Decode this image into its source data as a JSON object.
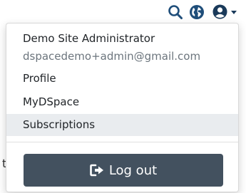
{
  "navbar": {
    "icons": [
      "search-icon",
      "globe-icon",
      "user-circle-icon",
      "caret-down-icon"
    ],
    "icon_color": "#1f4e7a"
  },
  "background": {
    "text": "t"
  },
  "user_menu": {
    "name": "Demo Site Administrator",
    "email": "dspacedemo+admin@gmail.com",
    "items": [
      {
        "label": "Profile"
      },
      {
        "label": "MyDSpace"
      },
      {
        "label": "Subscriptions",
        "highlighted": true
      }
    ],
    "logout": {
      "label": "Log out",
      "icon": "sign-out-icon",
      "color": "#43515f"
    }
  }
}
